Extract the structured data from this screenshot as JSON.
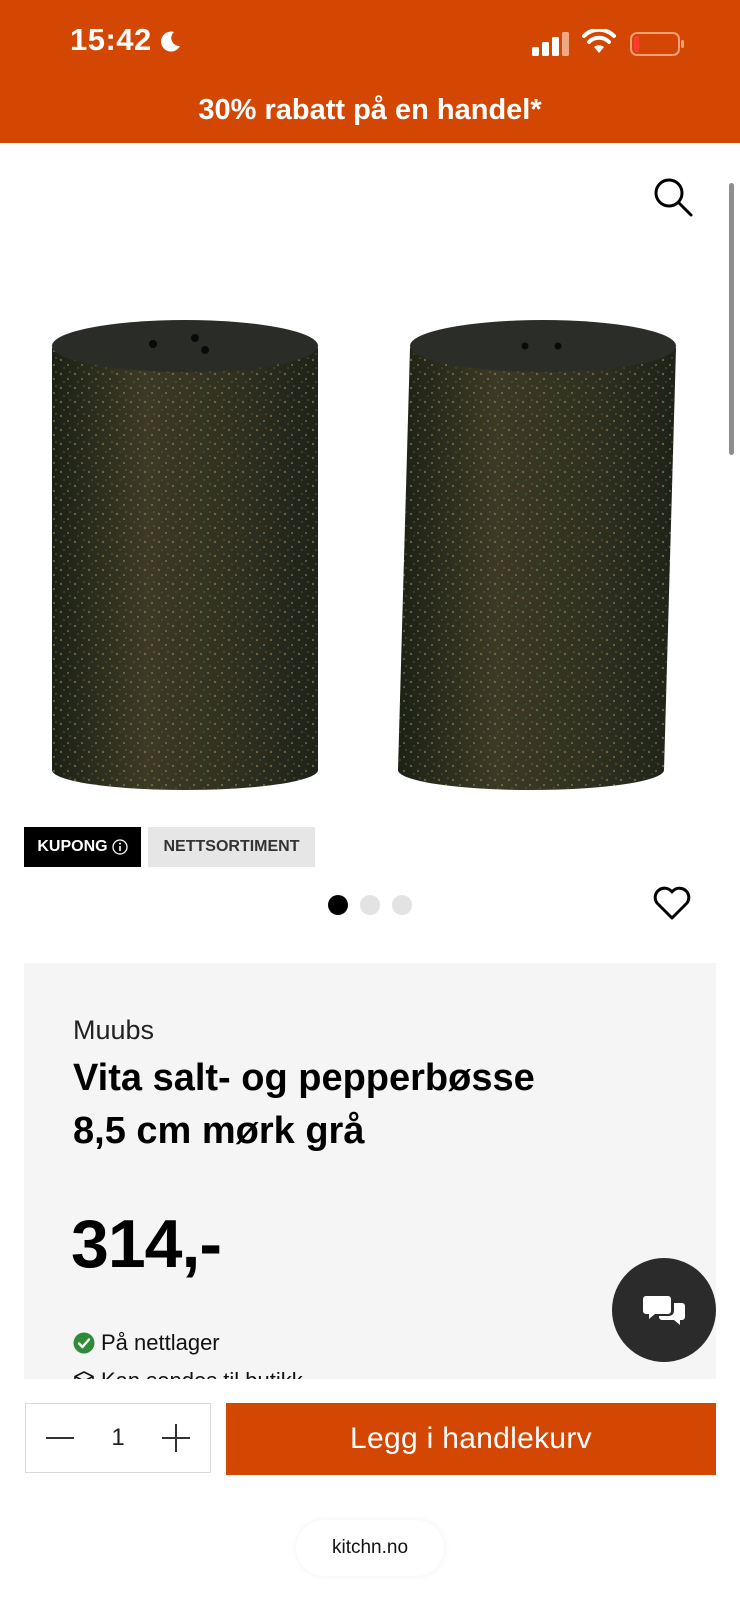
{
  "status_bar": {
    "time": "15:42"
  },
  "header": {
    "promo_text": "30% rabatt på en handel*",
    "bg_color": "#d34702"
  },
  "badges": {
    "kupong": "KUPONG",
    "nettsortiment": "NETTSORTIMENT"
  },
  "carousel": {
    "total": 3,
    "active_index": 0
  },
  "product": {
    "brand": "Muubs",
    "title_line1": "Vita salt- og pepperbøsse",
    "title_line2": "8,5 cm mørk grå",
    "price": "314,-",
    "stock_status": "På nettlager",
    "shipping_text": "Kan sendes til butikk"
  },
  "cart": {
    "quantity": "1",
    "add_label": "Legg i handlekurv"
  },
  "browser": {
    "url": "kitchn.no"
  },
  "icons": [
    "moon-icon",
    "signal-icon",
    "wifi-icon",
    "battery-icon",
    "search-icon",
    "info-icon",
    "heart-icon",
    "check-icon",
    "package-icon",
    "chat-icon",
    "minus-icon",
    "plus-icon"
  ]
}
